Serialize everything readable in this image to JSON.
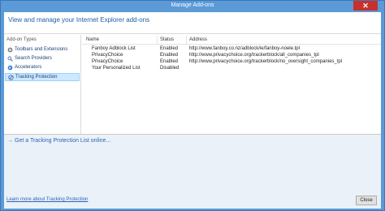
{
  "window": {
    "title": "Manage Add-ons"
  },
  "header": {
    "text": "View and manage your Internet Explorer add-ons"
  },
  "sidebar": {
    "title": "Add-on Types",
    "items": [
      {
        "label": "Toolbars and Extensions",
        "icon": "gear-icon"
      },
      {
        "label": "Search Providers",
        "icon": "search-icon"
      },
      {
        "label": "Accelerators",
        "icon": "accelerator-icon"
      },
      {
        "label": "Tracking Protection",
        "icon": "tracking-protection-icon",
        "selected": true
      }
    ]
  },
  "list": {
    "columns": {
      "name": "Name",
      "status": "Status",
      "address": "Address"
    },
    "rows": [
      {
        "name": "Fanboy Adblock List",
        "status": "Enabled",
        "address": "http://www.fanboy.co.nz/adblock/ie/fanboy-noele.tpl"
      },
      {
        "name": "PrivacyChoice",
        "status": "Enabled",
        "address": "http://www.privacychoice.org/trackerblock/all_companies_tpl"
      },
      {
        "name": "PrivacyChoice",
        "status": "Enabled",
        "address": "http://www.privacychoice.org/trackerblock/no_oversight_companies_tpl"
      },
      {
        "name": "Your Personalized List",
        "status": "Disabled",
        "address": ""
      }
    ]
  },
  "details": {
    "get_link": "Get a Tracking Protection List online..."
  },
  "footer": {
    "learn_link": "Learn more about Tracking Protection",
    "close_label": "Close"
  },
  "colors": {
    "titlebar": "#5b9ad6",
    "header_text": "#1f5fa8",
    "link": "#2b64b5",
    "selected": "#cde8ff",
    "details_bg": "#eaf1f9"
  }
}
